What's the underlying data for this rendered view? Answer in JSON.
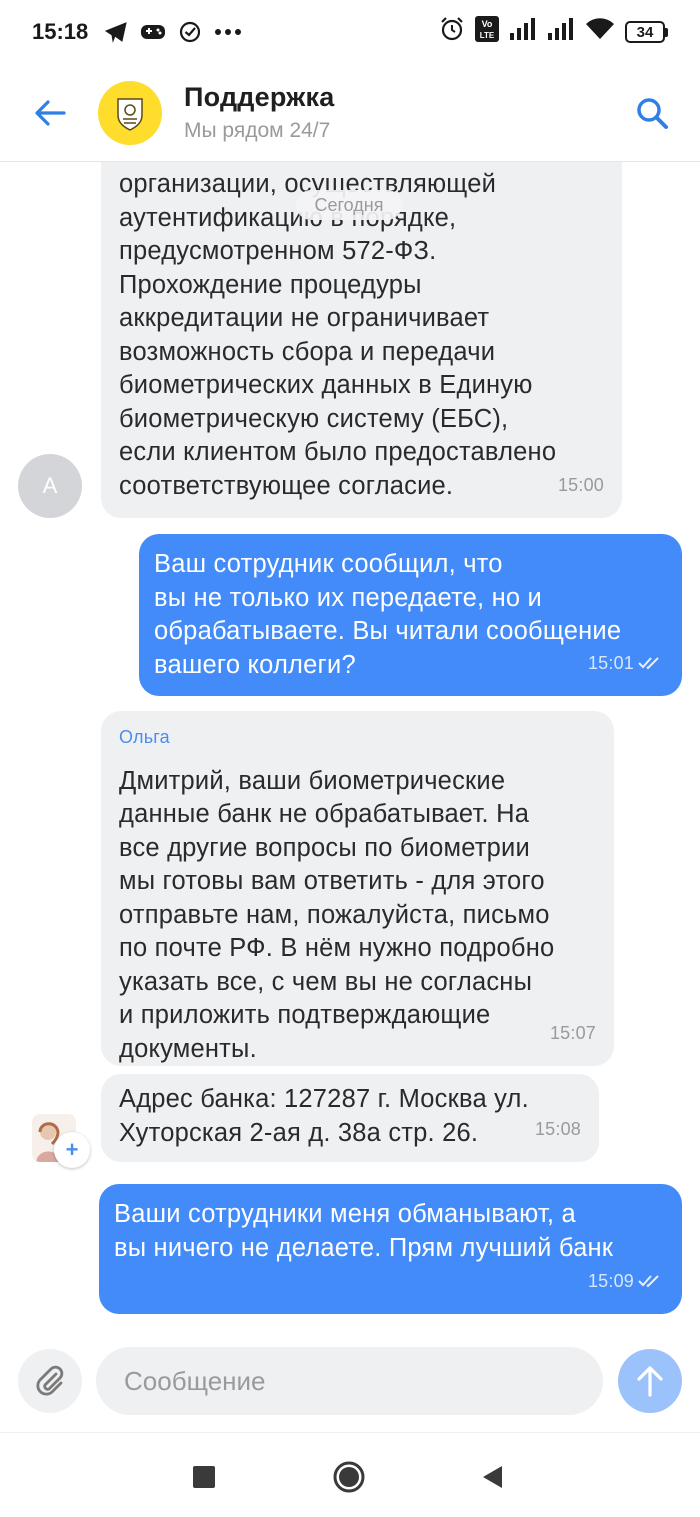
{
  "status_bar": {
    "time": "15:18",
    "battery": "34",
    "icons": [
      "telegram-icon",
      "gamepad-icon",
      "check-circle-icon",
      "more-dots-icon",
      "alarm-icon",
      "volte-icon",
      "signal-icon",
      "signal-icon",
      "wifi-icon",
      "battery-icon"
    ]
  },
  "header": {
    "title": "Поддержка",
    "subtitle": "Мы рядом 24/7",
    "back_icon": "arrow-left-icon",
    "search_icon": "search-icon",
    "accent": "#2f7fe6",
    "logo_color": "#ffdd2d"
  },
  "chat": {
    "date_chip": "Сегодня",
    "messages": [
      {
        "direction": "incoming",
        "avatar_letter": "A",
        "text": "организации, осуществляющей\nаутентификацию в порядке,\nпредусмотренном 572-ФЗ.\nПрохождение процедуры\nаккредитации не ограничивает\nвозможность сбора и передачи\nбиометрических данных в Единую\nбиометрическую систему (ЕБС),\nесли клиентом было предоставлено\nсоответствующее согласие.",
        "time": "15:00"
      },
      {
        "direction": "outgoing",
        "text": "Ваш сотрудник сообщил, что\nвы не только их передаете, но и\nобрабатываете. Вы читали сообщение\nвашего коллеги?",
        "time": "15:01"
      },
      {
        "direction": "incoming",
        "sender": "Ольга",
        "text": "Дмитрий, ваши биометрические\nданные банк не обрабатывает. На\nвсе другие вопросы по биометрии\nмы готовы вам ответить - для этого\nотправьте нам, пожалуйста, письмо\nпо почте РФ. В нём нужно подробно\nуказать все, с чем вы не согласны\nи приложить подтверждающие\nдокументы.",
        "time": "15:07"
      },
      {
        "direction": "incoming",
        "text": "Адрес банка: 127287 г. Москва ул.\nХуторская 2-ая д. 38а стр. 26.",
        "time": "15:08"
      },
      {
        "direction": "outgoing",
        "text": "Ваши сотрудники меня обманывают, а\nвы ничего не делаете. Прям лучший банк",
        "time": "15:09"
      }
    ],
    "incoming_color": "#eff0f2",
    "outgoing_color": "#428bf9",
    "sender_color": "#4a8df0"
  },
  "composer": {
    "placeholder": "Сообщение",
    "attach_icon": "paperclip-icon",
    "send_icon": "arrow-up-icon"
  },
  "nav_bar": {
    "icons": [
      "recents-square-icon",
      "home-circle-icon",
      "back-triangle-icon"
    ]
  }
}
